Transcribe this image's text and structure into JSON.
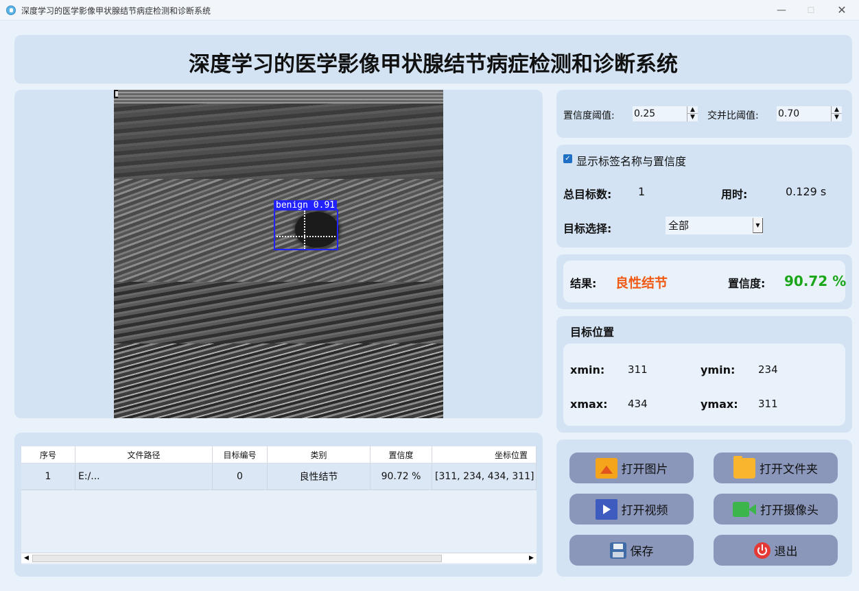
{
  "window": {
    "title": "深度学习的医学影像甲状腺结节病症检测和诊断系统",
    "minimize": "—",
    "maximize": "☐",
    "close": "✕"
  },
  "header": {
    "title": "深度学习的医学影像甲状腺结节病症检测和诊断系统"
  },
  "image": {
    "detection_label": "benign 0.91",
    "box_color": "#2222ff"
  },
  "thresholds": {
    "conf_label": "置信度阈值:",
    "conf_value": "0.25",
    "iou_label": "交并比阈值:",
    "iou_value": "0.70"
  },
  "settings": {
    "show_labels_text": "显示标签名称与置信度",
    "show_labels_checked": true,
    "total_label": "总目标数:",
    "total_value": "1",
    "time_label": "用时:",
    "time_value": "0.129 s",
    "target_select_label": "目标选择:",
    "target_select_value": "全部"
  },
  "result": {
    "result_label": "结果:",
    "result_value": "良性结节",
    "result_color": "#f05a14",
    "confidence_label": "置信度:",
    "confidence_value": "90.72 %",
    "confidence_color": "#19a619"
  },
  "position": {
    "title": "目标位置",
    "xmin_label": "xmin:",
    "xmin_value": "311",
    "ymin_label": "ymin:",
    "ymin_value": "234",
    "xmax_label": "xmax:",
    "xmax_value": "434",
    "ymax_label": "ymax:",
    "ymax_value": "311"
  },
  "buttons": {
    "open_image": "打开图片",
    "open_folder": "打开文件夹",
    "open_video": "打开视频",
    "open_camera": "打开摄像头",
    "save": "保存",
    "exit": "退出"
  },
  "table": {
    "headers": [
      "序号",
      "文件路径",
      "目标编号",
      "类别",
      "置信度",
      "坐标位置"
    ],
    "rows": [
      [
        "1",
        "E:/...",
        "0",
        "良性结节",
        "90.72 %",
        "[311, 234, 434, 311]"
      ]
    ]
  },
  "colors": {
    "panel": "#d3e3f4",
    "button": "#8a97bb"
  }
}
